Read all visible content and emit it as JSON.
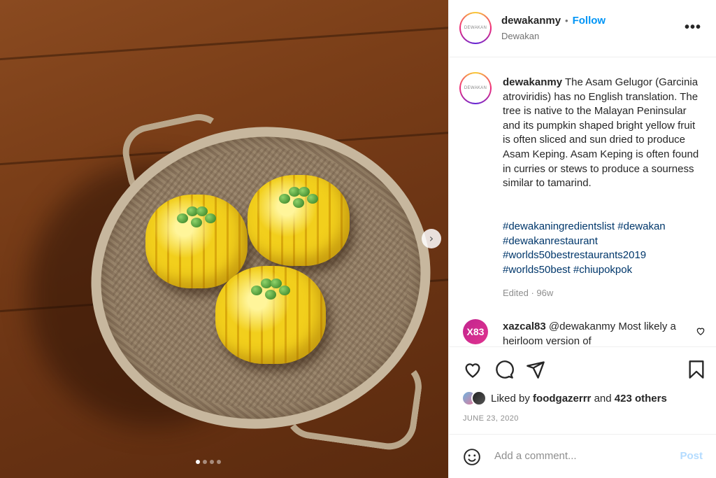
{
  "post": {
    "username": "dewakanmy",
    "separator": "•",
    "follow_label": "Follow",
    "location": "Dewakan",
    "avatar_text": "DEWAKAN",
    "more_icon": "more-horizontal-icon",
    "caption": "The Asam Gelugor (Garcinia atroviridis) has no English translation. The tree is native to the Malayan Peninsular and its pumpkin shaped bright yellow fruit is often sliced and sun dried to produce Asam Keping. Asam Keping is often found in curries or stews to produce a sourness similar to tamarind.",
    "hashtags": "#dewakaningredientslist #dewakan #dewakanrestaurant #worlds50bestrestaurants2019 #worlds50best #chiupokpok",
    "edited": "Edited · 96w"
  },
  "comment": {
    "username": "xazcal83",
    "avatar_text": "X83",
    "text": "@dewakanmy Most likely a heirloom version of"
  },
  "engagement": {
    "liked_by_prefix": "Liked by",
    "liked_by_user": "foodgazerrr",
    "and_text": "and",
    "others": "423 others",
    "date": "JUNE 23, 2020"
  },
  "add_comment": {
    "placeholder": "Add a comment...",
    "post_label": "Post"
  },
  "carousel": {
    "next_icon": "chevron-right-icon",
    "total_slides": 4,
    "active_slide": 1
  },
  "colors": {
    "follow": "#0095f6",
    "hashtag": "#00376b",
    "post_disabled": "#b3dbff",
    "secondary_text": "#8e8e8e"
  }
}
